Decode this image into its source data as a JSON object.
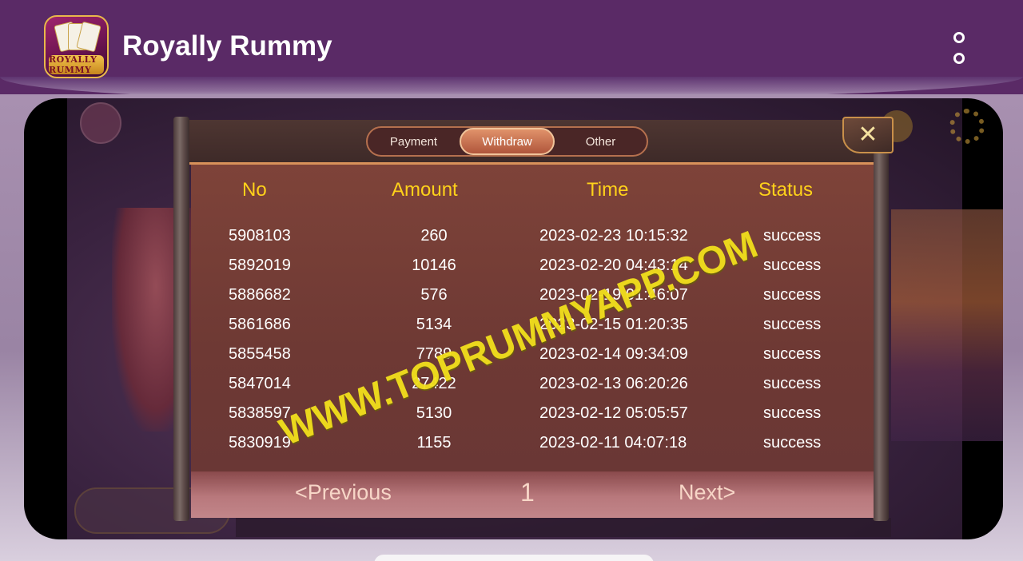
{
  "app": {
    "title": "Royally Rummy",
    "logo_text": "ROYALLY RUMMY",
    "menu_icon": "kebab-menu-icon"
  },
  "tabs": [
    {
      "label": "Payment",
      "active": false
    },
    {
      "label": "Withdraw",
      "active": true
    },
    {
      "label": "Other",
      "active": false
    }
  ],
  "close_icon": "close-icon",
  "table": {
    "headers": {
      "no": "No",
      "amount": "Amount",
      "time": "Time",
      "status": "Status"
    },
    "rows": [
      {
        "no": "5908103",
        "amount": "260",
        "time": "2023-02-23 10:15:32",
        "status": "success"
      },
      {
        "no": "5892019",
        "amount": "10146",
        "time": "2023-02-20 04:43:14",
        "status": "success"
      },
      {
        "no": "5886682",
        "amount": "576",
        "time": "2023-02-19 01:46:07",
        "status": "success"
      },
      {
        "no": "5861686",
        "amount": "5134",
        "time": "2023-02-15 01:20:35",
        "status": "success"
      },
      {
        "no": "5855458",
        "amount": "7789",
        "time": "2023-02-14 09:34:09",
        "status": "success"
      },
      {
        "no": "5847014",
        "amount": "27422",
        "time": "2023-02-13 06:20:26",
        "status": "success"
      },
      {
        "no": "5838597",
        "amount": "5130",
        "time": "2023-02-12 05:05:57",
        "status": "success"
      },
      {
        "no": "5830919",
        "amount": "1155",
        "time": "2023-02-11 04:07:18",
        "status": "success"
      }
    ]
  },
  "pagination": {
    "previous": "<Previous",
    "page": "1",
    "next": "Next>"
  },
  "watermark": "WWW.TOPRUMMYAPP.COM",
  "colors": {
    "appbar": "#5a2a66",
    "header_text": "#ffd21a",
    "watermark": "#f2e01c"
  }
}
